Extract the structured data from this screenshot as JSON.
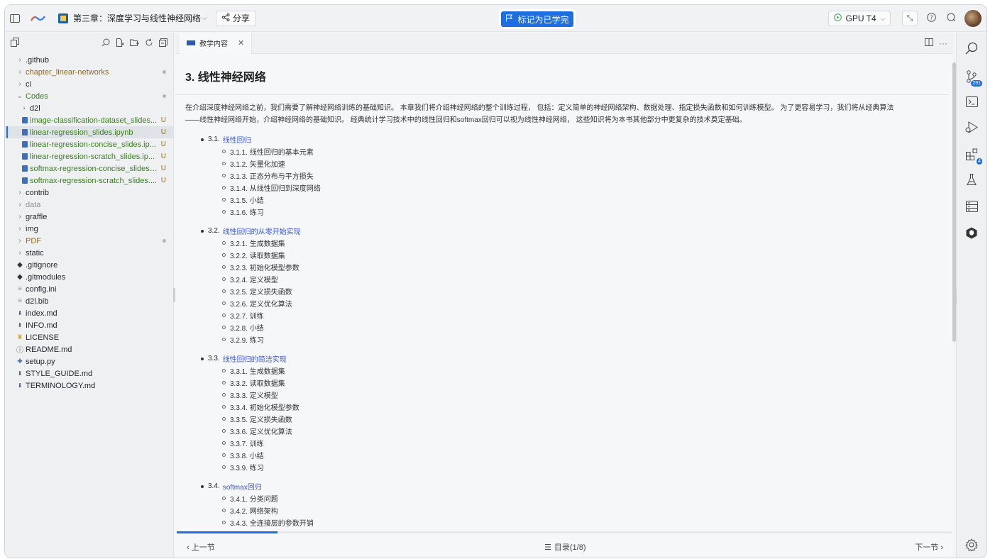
{
  "header": {
    "chapter_title": "第三章：深度学习与线性神经网络",
    "share_label": "分享",
    "mark_complete_label": "标记为已学完",
    "gpu_label": "GPU T4"
  },
  "sidebar": {
    "items": [
      {
        "label": ".github",
        "kind": "folder",
        "color": "normal",
        "indent": 0
      },
      {
        "label": "chapter_linear-networks",
        "kind": "folder",
        "color": "olive",
        "indent": 0,
        "dot": true
      },
      {
        "label": "ci",
        "kind": "folder",
        "color": "normal",
        "indent": 0
      },
      {
        "label": "Codes",
        "kind": "folder-open",
        "color": "green",
        "indent": 0,
        "dot": true
      },
      {
        "label": "d2l",
        "kind": "folder",
        "color": "normal",
        "indent": 1
      },
      {
        "label": "image-classification-dataset_slides...",
        "kind": "notebook",
        "color": "green",
        "indent": 1,
        "badge": "U"
      },
      {
        "label": "linear-regression_slides.ipynb",
        "kind": "notebook",
        "color": "green",
        "indent": 1,
        "badge": "U",
        "active": true
      },
      {
        "label": "linear-regression-concise_slides.ip...",
        "kind": "notebook",
        "color": "green",
        "indent": 1,
        "badge": "U"
      },
      {
        "label": "linear-regression-scratch_slides.ip...",
        "kind": "notebook",
        "color": "green",
        "indent": 1,
        "badge": "U"
      },
      {
        "label": "softmax-regression-concise_slides....",
        "kind": "notebook",
        "color": "green",
        "indent": 1,
        "badge": "U"
      },
      {
        "label": "softmax-regression-scratch_slides....",
        "kind": "notebook",
        "color": "green",
        "indent": 1,
        "badge": "U"
      },
      {
        "label": "contrib",
        "kind": "folder",
        "color": "normal",
        "indent": 0
      },
      {
        "label": "data",
        "kind": "folder",
        "color": "grey",
        "indent": 0
      },
      {
        "label": "graffle",
        "kind": "folder",
        "color": "normal",
        "indent": 0
      },
      {
        "label": "img",
        "kind": "folder",
        "color": "normal",
        "indent": 0
      },
      {
        "label": "PDF",
        "kind": "folder",
        "color": "olive",
        "indent": 0,
        "dot": true
      },
      {
        "label": "static",
        "kind": "folder",
        "color": "normal",
        "indent": 0
      },
      {
        "label": ".gitignore",
        "kind": "diamond",
        "color": "normal",
        "indent": 0
      },
      {
        "label": ".gitmodules",
        "kind": "diamond",
        "color": "normal",
        "indent": 0
      },
      {
        "label": "config.ini",
        "kind": "lines",
        "color": "normal",
        "indent": 0
      },
      {
        "label": "d2l.bib",
        "kind": "lines",
        "color": "normal",
        "indent": 0
      },
      {
        "label": "index.md",
        "kind": "md",
        "color": "normal",
        "indent": 0
      },
      {
        "label": "INFO.md",
        "kind": "md",
        "color": "normal",
        "indent": 0
      },
      {
        "label": "LICENSE",
        "kind": "license",
        "color": "normal",
        "indent": 0
      },
      {
        "label": "README.md",
        "kind": "info",
        "color": "normal",
        "indent": 0
      },
      {
        "label": "setup.py",
        "kind": "py",
        "color": "normal",
        "indent": 0
      },
      {
        "label": "STYLE_GUIDE.md",
        "kind": "md",
        "color": "normal",
        "indent": 0
      },
      {
        "label": "TERMINOLOGY.md",
        "kind": "md",
        "color": "normal",
        "indent": 0
      }
    ]
  },
  "tab": {
    "label": "教学内容"
  },
  "content": {
    "title": "3. 线性神经网络",
    "intro_line1": "在介绍深度神经网络之前，我们需要了解神经网络训练的基础知识。 本章我们将介绍神经网络的整个训练过程， 包括：定义简单的神经网络架构、数据处理、指定损失函数和如何训练模型。 为了更容易学习，我们将从经典算法",
    "intro_line2": "——线性神经网络开始，介绍神经网络的基础知识。 经典统计学习技术中的线性回归和softmax回归可以视为线性神经网络， 这些知识将为本书其他部分中更复杂的技术奠定基础。",
    "sections": [
      {
        "num": "3.1.",
        "title": "线性回归",
        "subs": [
          "3.1.1. 线性回归的基本元素",
          "3.1.2. 矢量化加速",
          "3.1.3. 正态分布与平方损失",
          "3.1.4. 从线性回归到深度网络",
          "3.1.5. 小结",
          "3.1.6. 练习"
        ]
      },
      {
        "num": "3.2.",
        "title": "线性回归的从零开始实现",
        "subs": [
          "3.2.1. 生成数据集",
          "3.2.2. 读取数据集",
          "3.2.3. 初始化模型参数",
          "3.2.4. 定义模型",
          "3.2.5. 定义损失函数",
          "3.2.6. 定义优化算法",
          "3.2.7. 训练",
          "3.2.8. 小结",
          "3.2.9. 练习"
        ]
      },
      {
        "num": "3.3.",
        "title": "线性回归的简洁实现",
        "subs": [
          "3.3.1. 生成数据集",
          "3.3.2. 读取数据集",
          "3.3.3. 定义模型",
          "3.3.4. 初始化模型参数",
          "3.3.5. 定义损失函数",
          "3.3.6. 定义优化算法",
          "3.3.7. 训练",
          "3.3.8. 小结",
          "3.3.9. 练习"
        ]
      },
      {
        "num": "3.4.",
        "title": "softmax回归",
        "subs": [
          "3.4.1. 分类问题",
          "3.4.2. 网络架构",
          "3.4.3. 全连接层的参数开销"
        ]
      }
    ]
  },
  "progress": 0.13,
  "footer": {
    "prev_label": "上一节",
    "toc_label": "目录(1/8)",
    "next_label": "下一节"
  },
  "rightbar": {
    "git_badge": "291",
    "ext_badge": "4"
  },
  "colors": {
    "accent": "#1d6fe0",
    "link": "#3c58c8",
    "git_green": "#3b7d22",
    "git_modified": "#8a6b25"
  }
}
